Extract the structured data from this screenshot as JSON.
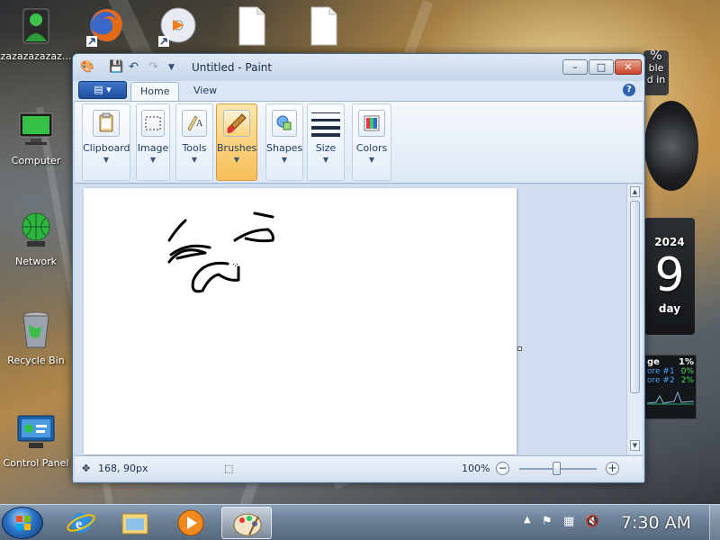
{
  "desktop": {
    "icons": [
      {
        "label": "zazazazazaz...",
        "icon": "user-icon"
      },
      {
        "label": "Computer",
        "icon": "computer-icon"
      },
      {
        "label": "Network",
        "icon": "network-icon"
      },
      {
        "label": "Recycle Bin",
        "icon": "recycle-bin-icon"
      },
      {
        "label": "Control Panel",
        "icon": "control-panel-icon"
      }
    ],
    "top_icons": [
      {
        "label": "",
        "icon": "firefox-icon"
      },
      {
        "label": "",
        "icon": "media-player-disc-icon"
      },
      {
        "label": "",
        "icon": "document-icon"
      },
      {
        "label": "",
        "icon": "document-icon"
      }
    ]
  },
  "gadgets": {
    "weather_partial": [
      "%",
      "ble",
      "d in"
    ],
    "calendar": {
      "year": "2024",
      "day_number": "9",
      "weekday_partial": "day"
    },
    "cpu": {
      "title_partial": "ge",
      "total": "1%",
      "cores": [
        {
          "label": "ore #1",
          "value": "0%"
        },
        {
          "label": "ore #2",
          "value": "2%"
        }
      ]
    }
  },
  "paint": {
    "title": "Untitled - Paint",
    "tabs": [
      {
        "label": "Home",
        "active": true
      },
      {
        "label": "View",
        "active": false
      }
    ],
    "ribbon_groups": [
      {
        "label": "Clipboard",
        "icon": "clipboard-icon"
      },
      {
        "label": "Image",
        "icon": "select-icon"
      },
      {
        "label": "Tools",
        "icon": "tools-icon"
      },
      {
        "label": "Brushes",
        "icon": "brush-icon",
        "highlighted": true
      },
      {
        "label": "Shapes",
        "icon": "shapes-icon"
      },
      {
        "label": "Size",
        "icon": "line-size-icon"
      },
      {
        "label": "Colors",
        "icon": "color-palette-icon"
      }
    ],
    "status": {
      "cursor_pos": "168, 90px",
      "zoom": "100%",
      "zoom_level": 1.0
    }
  },
  "taskbar": {
    "buttons": [
      {
        "name": "internet-explorer-icon"
      },
      {
        "name": "file-explorer-icon"
      },
      {
        "name": "media-player-icon"
      },
      {
        "name": "paint-icon",
        "active": true
      }
    ],
    "clock": "7:30 AM"
  }
}
